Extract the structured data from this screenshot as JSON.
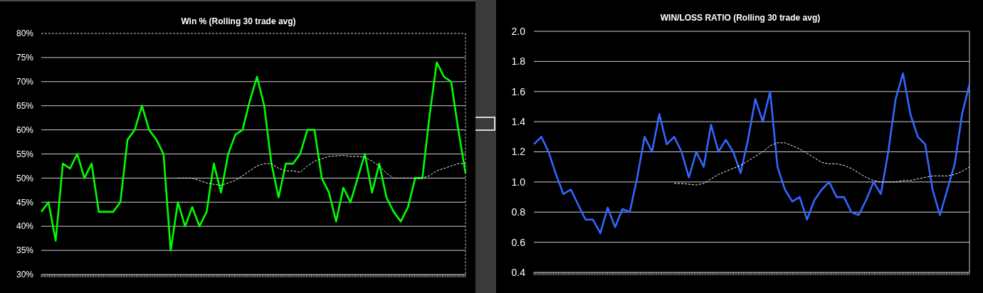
{
  "panels": [
    {
      "chart_data": {
        "type": "line",
        "title": "Win % (Rolling 30 trade avg)",
        "ylim": [
          30,
          80
        ],
        "grid": true,
        "yticks": [
          {
            "value": 30,
            "label": "30%"
          },
          {
            "value": 35,
            "label": "35%"
          },
          {
            "value": 40,
            "label": "40%"
          },
          {
            "value": 45,
            "label": "45%"
          },
          {
            "value": 50,
            "label": "50%"
          },
          {
            "value": 55,
            "label": "55%"
          },
          {
            "value": 60,
            "label": "60%"
          },
          {
            "value": 65,
            "label": "65%"
          },
          {
            "value": 70,
            "label": "70%"
          },
          {
            "value": 75,
            "label": "75%"
          },
          {
            "value": 80,
            "label": "80%"
          }
        ],
        "series": [
          {
            "line_style": "solid",
            "color": "#00ff00",
            "values": [
              43,
              45,
              37,
              53,
              52,
              55,
              50,
              53,
              43,
              43,
              43,
              45,
              58,
              60,
              65,
              60,
              58,
              55,
              35,
              45,
              40,
              44,
              40,
              43,
              53,
              47,
              55,
              59,
              60,
              66,
              71,
              65,
              53,
              46,
              53,
              53,
              55,
              60,
              60,
              50,
              47,
              41,
              48,
              45,
              50,
              55,
              47,
              53,
              46,
              43,
              41,
              44,
              50,
              50,
              63,
              74,
              71,
              70,
              60,
              51
            ]
          },
          {
            "line_style": "dashed",
            "color": "#ffffff",
            "values": [
              null,
              null,
              null,
              null,
              null,
              null,
              null,
              null,
              null,
              null,
              null,
              null,
              null,
              null,
              null,
              null,
              null,
              null,
              null,
              50,
              50,
              50,
              49.5,
              49,
              48.7,
              48.5,
              49,
              49.5,
              50.5,
              51.5,
              52.5,
              53,
              53,
              52,
              51.5,
              51.5,
              51.2,
              52.5,
              53.5,
              54,
              54.5,
              54.6,
              54.7,
              54.5,
              54.5,
              54.3,
              53.5,
              52.5,
              51,
              50,
              50,
              50,
              50,
              50,
              50.5,
              51.5,
              52,
              52.5,
              53,
              53
            ]
          }
        ]
      }
    },
    {
      "chart_data": {
        "type": "line",
        "title": "WIN/LOSS RATIO (Rolling 30 trade avg)",
        "ylim": [
          0.4,
          2.0
        ],
        "grid": true,
        "yticks": [
          {
            "value": 0.4,
            "label": "0.4"
          },
          {
            "value": 0.6,
            "label": "0.6"
          },
          {
            "value": 0.8,
            "label": "0.8"
          },
          {
            "value": 1.0,
            "label": "1.0"
          },
          {
            "value": 1.2,
            "label": "1.2"
          },
          {
            "value": 1.4,
            "label": "1.4"
          },
          {
            "value": 1.6,
            "label": "1.6"
          },
          {
            "value": 1.8,
            "label": "1.8"
          },
          {
            "value": 2.0,
            "label": "2.0"
          }
        ],
        "series": [
          {
            "line_style": "solid",
            "color": "#3366ff",
            "values": [
              1.25,
              1.3,
              1.2,
              1.05,
              0.92,
              0.95,
              0.85,
              0.75,
              0.75,
              0.66,
              0.83,
              0.7,
              0.82,
              0.8,
              1.03,
              1.3,
              1.2,
              1.45,
              1.25,
              1.3,
              1.2,
              1.03,
              1.2,
              1.1,
              1.38,
              1.2,
              1.28,
              1.2,
              1.06,
              1.28,
              1.55,
              1.4,
              1.6,
              1.1,
              0.95,
              0.87,
              0.9,
              0.75,
              0.88,
              0.95,
              1.0,
              0.9,
              0.9,
              0.8,
              0.78,
              0.88,
              1.0,
              0.92,
              1.2,
              1.55,
              1.72,
              1.45,
              1.3,
              1.25,
              0.95,
              0.78,
              0.95,
              1.12,
              1.45,
              1.65
            ]
          },
          {
            "line_style": "dashed",
            "color": "#ffffff",
            "values": [
              null,
              null,
              null,
              null,
              null,
              null,
              null,
              null,
              null,
              null,
              null,
              null,
              null,
              null,
              null,
              null,
              null,
              null,
              null,
              0.99,
              0.99,
              0.985,
              0.98,
              0.99,
              1.02,
              1.05,
              1.07,
              1.09,
              1.11,
              1.14,
              1.17,
              1.2,
              1.24,
              1.26,
              1.26,
              1.24,
              1.22,
              1.19,
              1.16,
              1.13,
              1.12,
              1.12,
              1.11,
              1.09,
              1.06,
              1.03,
              1.01,
              1.0,
              1.0,
              1.0,
              1.01,
              1.01,
              1.02,
              1.03,
              1.04,
              1.04,
              1.04,
              1.05,
              1.07,
              1.1
            ]
          }
        ]
      }
    }
  ]
}
